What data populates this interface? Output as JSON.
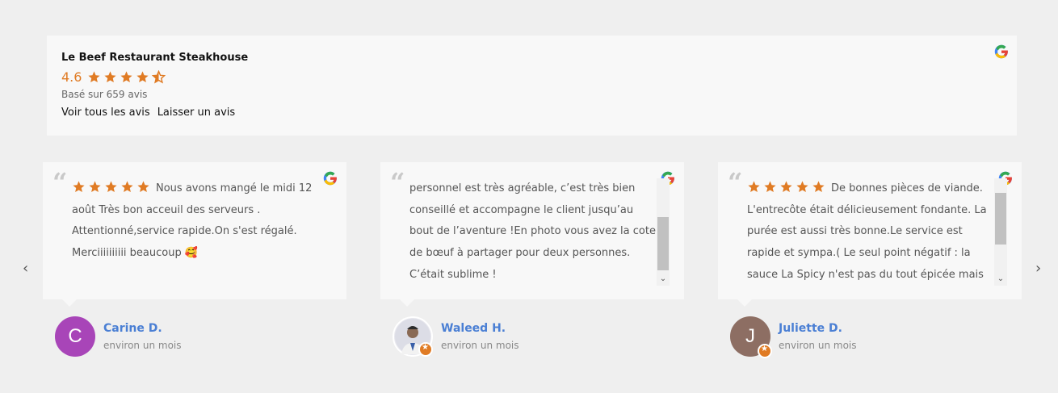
{
  "business": {
    "name": "Le Beef Restaurant Steakhouse",
    "rating": "4.6",
    "stars": 4.5,
    "count_text": "Basé sur 659 avis",
    "link_all": "Voir tous les avis",
    "link_leave": "Laisser un avis"
  },
  "nav": {
    "prev": "‹",
    "next": "›"
  },
  "reviews": [
    {
      "stars": 5,
      "text": "Nous avons mangé le midi 12 août Très bon acceuil des serveurs . Attentionné,service rapide.On s'est régalé. Merciiiiiiiiii beaucoup 🥰",
      "author": "Carine D.",
      "initial": "C",
      "time": "environ un mois"
    },
    {
      "stars": 0,
      "text": "personnel est très agréable, c’est très bien conseillé et accompagne le client jusqu’au bout de l’aventure !En photo vous avez la cote de bœuf à partager pour deux personnes. C’était sublime !",
      "author": "Waleed H.",
      "initial": "",
      "time": "environ un mois"
    },
    {
      "stars": 5,
      "text": "De bonnes pièces de viande. L'entrecôte était délicieusement fondante. La purée est aussi très bonne.Le service est rapide et sympa.( Le seul point négatif : la sauce La Spicy n'est pas du tout épicée mais plutôt",
      "author": "Juliette D.",
      "initial": "J",
      "time": "environ un mois"
    }
  ],
  "colors": {
    "accent": "#e07b24",
    "name_blue": "#4a7fd4",
    "avatar_c": "#a845b8",
    "avatar_j": "#8d6e63"
  },
  "icons": [
    "google-icon",
    "star-icon",
    "quote-icon",
    "chevron-left-icon",
    "chevron-right-icon"
  ]
}
